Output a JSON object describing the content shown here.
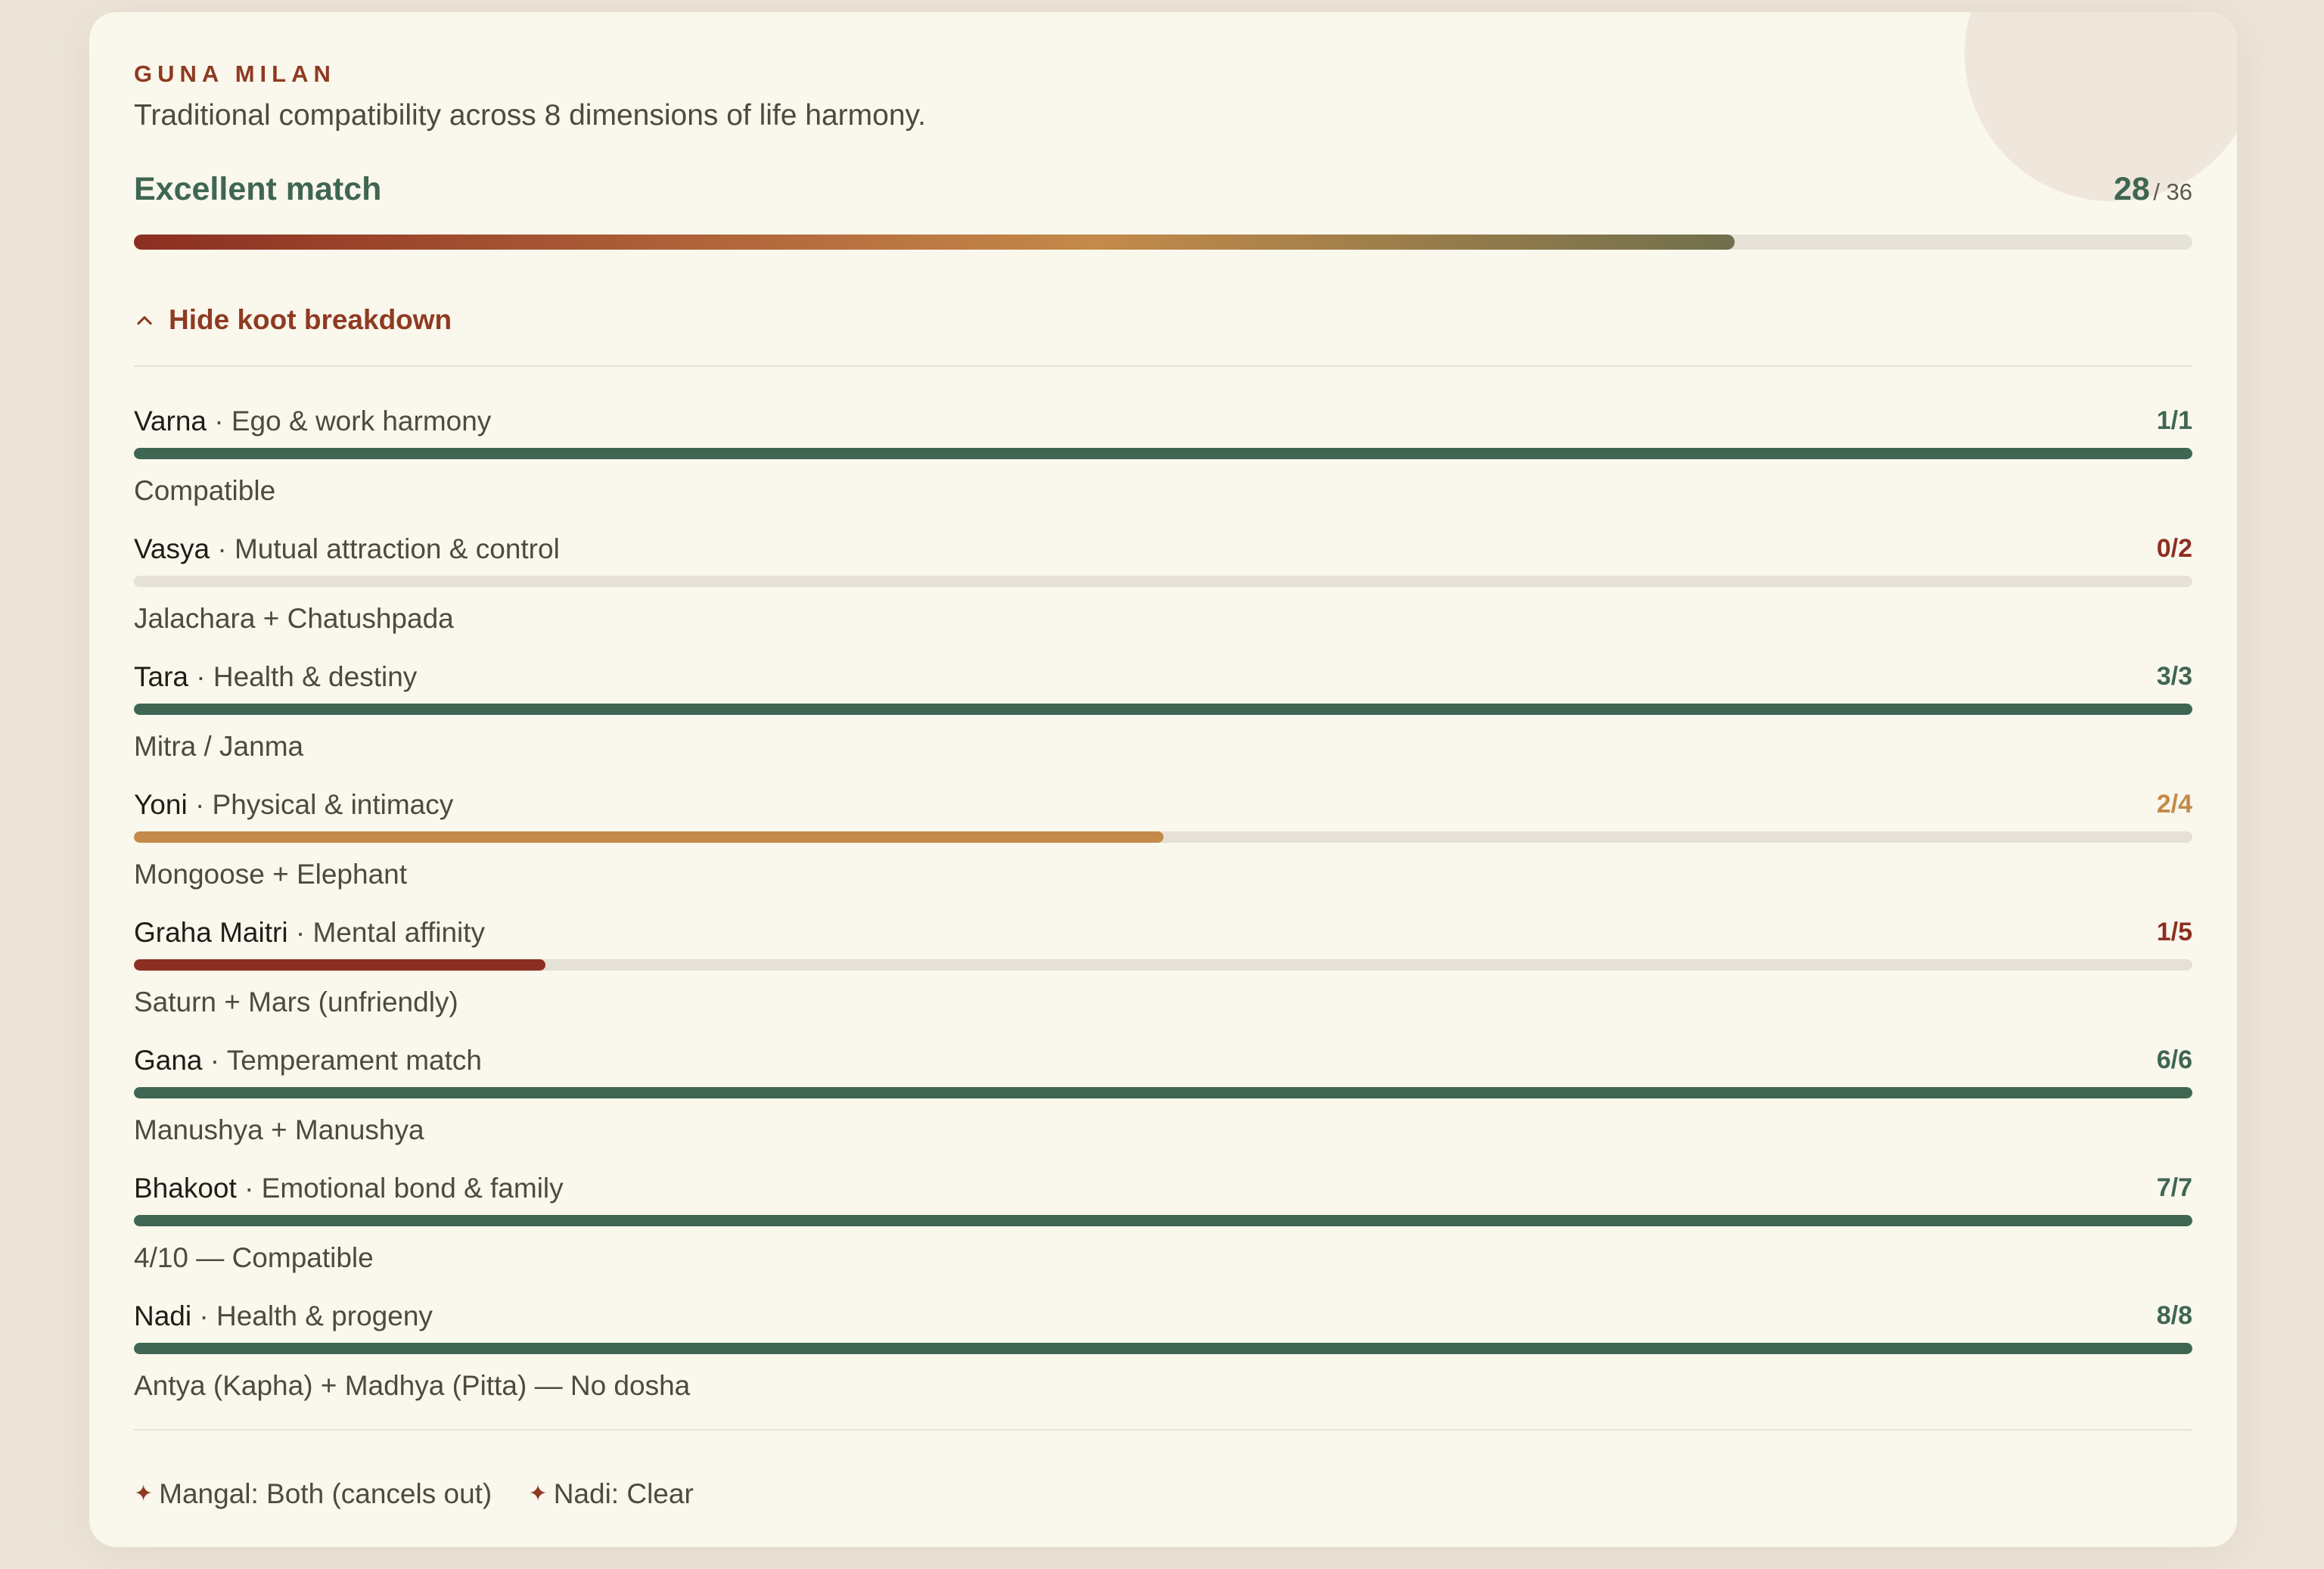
{
  "header": {
    "kicker": "GUNA MILAN",
    "subtitle": "Traditional compatibility across 8 dimensions of life harmony."
  },
  "summary": {
    "label": "Excellent match",
    "score": "28",
    "max": "/ 36",
    "fraction": 0.7778
  },
  "toggle": {
    "label": "Hide koot breakdown",
    "icon": "chevron-up-icon"
  },
  "koots": [
    {
      "name": "Varna",
      "desc": "· Ego & work harmony",
      "score": "1/1",
      "detail": "Compatible",
      "fraction": 1.0,
      "color": "#3e6653"
    },
    {
      "name": "Vasya",
      "desc": "· Mutual attraction & control",
      "score": "0/2",
      "detail": "Jalachara + Chatushpada",
      "fraction": 0.0,
      "color": "#8c2f22"
    },
    {
      "name": "Tara",
      "desc": "· Health & destiny",
      "score": "3/3",
      "detail": "Mitra / Janma",
      "fraction": 1.0,
      "color": "#3e6653"
    },
    {
      "name": "Yoni",
      "desc": "· Physical & intimacy",
      "score": "2/4",
      "detail": "Mongoose + Elephant",
      "fraction": 0.5,
      "color": "#c48a4a"
    },
    {
      "name": "Graha Maitri",
      "desc": "· Mental affinity",
      "score": "1/5",
      "detail": "Saturn + Mars (unfriendly)",
      "fraction": 0.2,
      "color": "#8c2f22"
    },
    {
      "name": "Gana",
      "desc": "· Temperament match",
      "score": "6/6",
      "detail": "Manushya + Manushya",
      "fraction": 1.0,
      "color": "#3e6653"
    },
    {
      "name": "Bhakoot",
      "desc": "· Emotional bond & family",
      "score": "7/7",
      "detail": "4/10 — Compatible",
      "fraction": 1.0,
      "color": "#3e6653"
    },
    {
      "name": "Nadi",
      "desc": "· Health & progeny",
      "score": "8/8",
      "detail": "Antya (Kapha) + Madhya (Pitta) — No dosha",
      "fraction": 1.0,
      "color": "#3e6653"
    }
  ],
  "footer": {
    "items": [
      {
        "icon": "sparkle-icon",
        "glyph": "✦",
        "text": "Mangal: Both (cancels out)"
      },
      {
        "icon": "sparkle-icon",
        "glyph": "✦",
        "text": "Nadi: Clear"
      }
    ]
  }
}
